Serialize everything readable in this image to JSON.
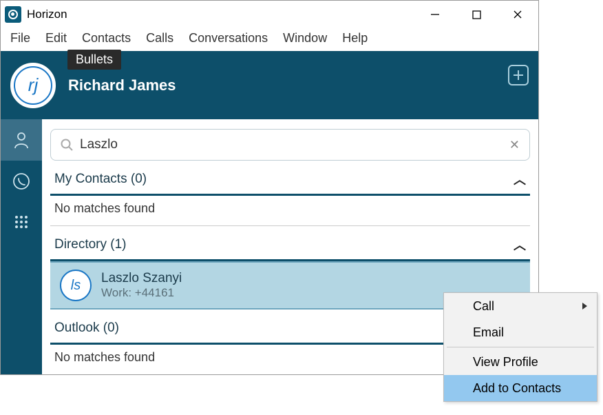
{
  "app": {
    "title": "Horizon"
  },
  "menubar": [
    "File",
    "Edit",
    "Contacts",
    "Calls",
    "Conversations",
    "Window",
    "Help"
  ],
  "tooltip": "Bullets",
  "header": {
    "avatar_initials": "rj",
    "username": "Richard James"
  },
  "search": {
    "value": "Laszlo"
  },
  "sections": {
    "my_contacts": {
      "title": "My Contacts (0)",
      "empty_text": "No matches found"
    },
    "directory": {
      "title": "Directory (1)",
      "contact": {
        "initials": "ls",
        "name": "Laszlo Szanyi",
        "detail": "Work: +44161"
      }
    },
    "outlook": {
      "title": "Outlook (0)",
      "empty_text": "No matches found"
    }
  },
  "context_menu": {
    "call": "Call",
    "email": "Email",
    "view_profile": "View Profile",
    "add_to_contacts": "Add to Contacts"
  }
}
